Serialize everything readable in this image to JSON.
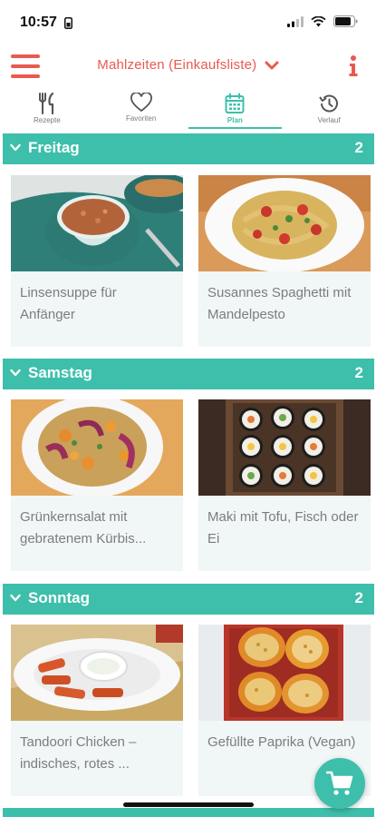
{
  "status_bar": {
    "time": "10:57"
  },
  "header": {
    "title": "Mahlzeiten (Einkaufsliste)",
    "accent": "#e85a4f"
  },
  "tabs": [
    {
      "label": "Rezepte",
      "icon": "fork-knife-icon",
      "active": false
    },
    {
      "label": "Favoriten",
      "icon": "heart-icon",
      "active": false
    },
    {
      "label": "Plan",
      "icon": "calendar-icon",
      "active": true
    },
    {
      "label": "Verlauf",
      "icon": "history-icon",
      "active": false
    }
  ],
  "theme": {
    "teal": "#3dbfab",
    "card_bg": "#f1f6f7"
  },
  "days": [
    {
      "name": "Freitag",
      "count": "2",
      "recipes": [
        {
          "title": "Linsensuppe für Anfänger",
          "line1": "Linsensuppe für",
          "line2": "Anfänger"
        },
        {
          "title": "Susannes Spaghetti mit Mandelpesto",
          "line1": "Susannes Spaghetti mit",
          "line2": "Mandelpesto"
        }
      ]
    },
    {
      "name": "Samstag",
      "count": "2",
      "recipes": [
        {
          "title": "Grünkernsalat mit gebratenem Kürbis...",
          "line1": "Grünkernsalat mit",
          "line2": "gebratenem Kürbis..."
        },
        {
          "title": "Maki mit Tofu, Fisch oder Ei",
          "line1": "Maki mit Tofu, Fisch oder",
          "line2": "Ei"
        }
      ]
    },
    {
      "name": "Sonntag",
      "count": "2",
      "recipes": [
        {
          "title": "Tandoori Chicken – indisches, rotes ...",
          "line1": "Tandoori Chicken –",
          "line2": "indisches, rotes ..."
        },
        {
          "title": "Gefüllte Paprika (Vegan)",
          "line1": "Gefüllte Paprika (Vegan)",
          "line2": ""
        }
      ]
    }
  ],
  "cart": {
    "icon": "shopping-cart-icon"
  }
}
